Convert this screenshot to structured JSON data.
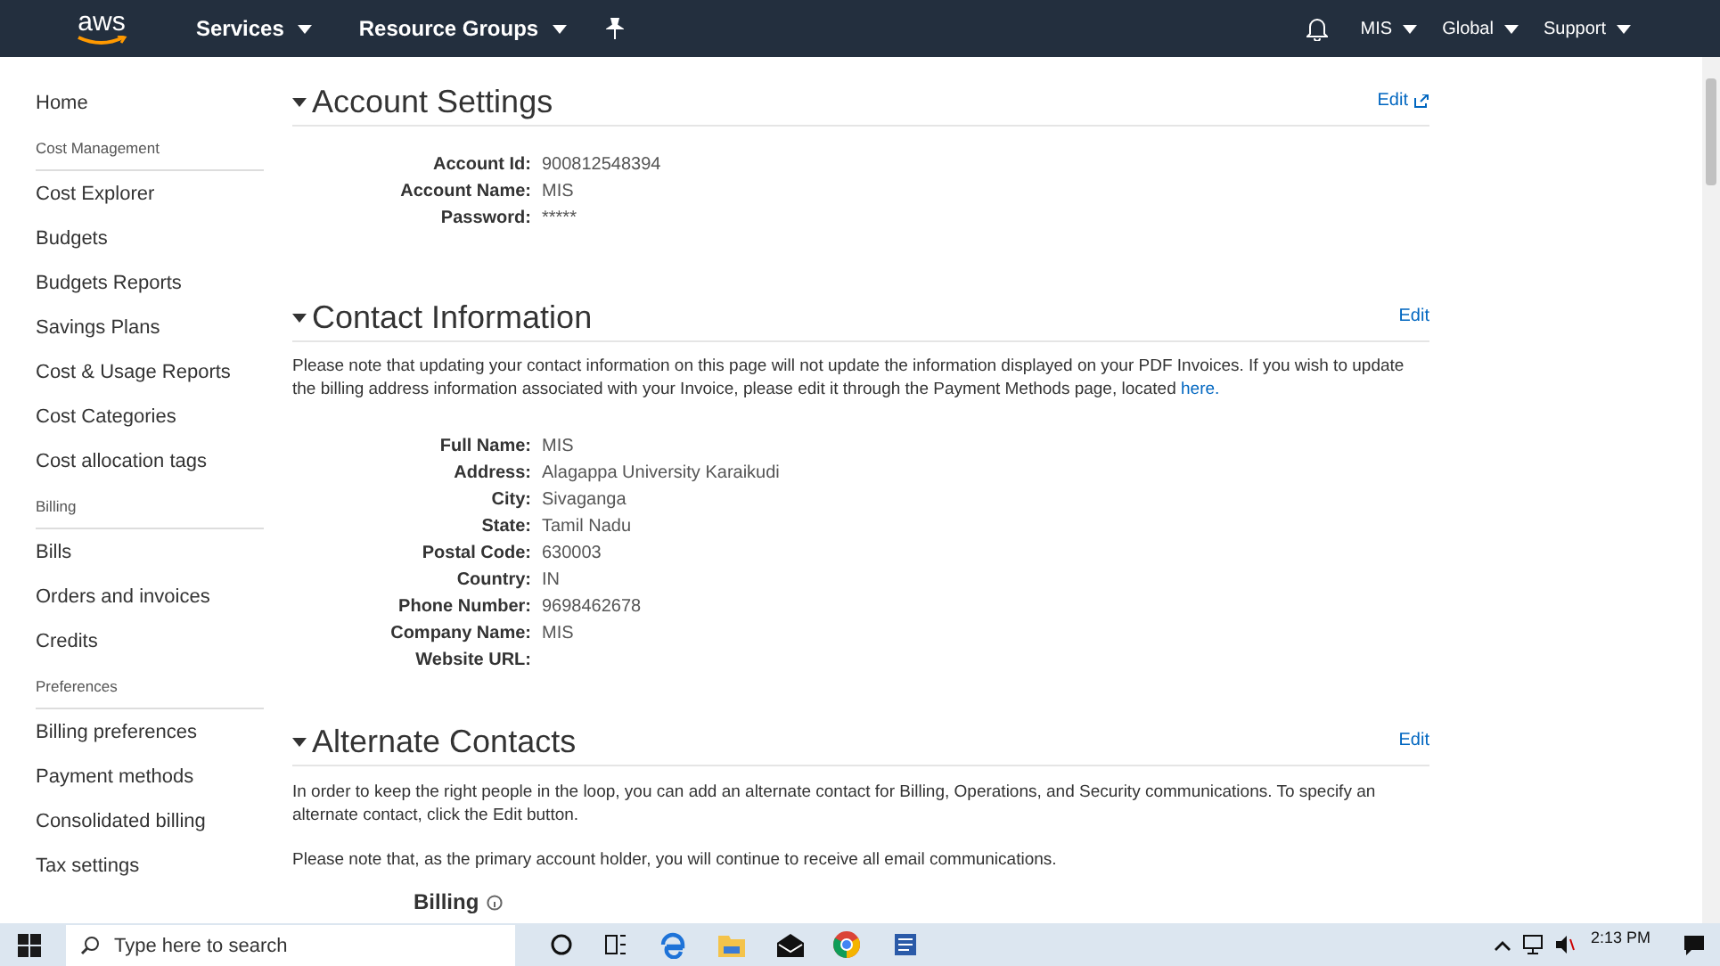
{
  "top_nav": {
    "logo": "aws",
    "menus": [
      {
        "label": "Services"
      },
      {
        "label": "Resource Groups"
      }
    ],
    "right_menus": [
      {
        "label": "MIS"
      },
      {
        "label": "Global"
      },
      {
        "label": "Support"
      }
    ]
  },
  "sidebar": {
    "items": [
      {
        "kind": "link",
        "label": "Home"
      },
      {
        "kind": "heading",
        "label": "Cost Management"
      },
      {
        "kind": "link",
        "label": "Cost Explorer"
      },
      {
        "kind": "link",
        "label": "Budgets"
      },
      {
        "kind": "link",
        "label": "Budgets Reports"
      },
      {
        "kind": "link",
        "label": "Savings Plans"
      },
      {
        "kind": "link",
        "label": "Cost & Usage Reports"
      },
      {
        "kind": "link",
        "label": "Cost Categories"
      },
      {
        "kind": "link",
        "label": "Cost allocation tags"
      },
      {
        "kind": "heading",
        "label": "Billing"
      },
      {
        "kind": "link",
        "label": "Bills"
      },
      {
        "kind": "link",
        "label": "Orders and invoices"
      },
      {
        "kind": "link",
        "label": "Credits"
      },
      {
        "kind": "heading",
        "label": "Preferences"
      },
      {
        "kind": "link",
        "label": "Billing preferences"
      },
      {
        "kind": "link",
        "label": "Payment methods"
      },
      {
        "kind": "link",
        "label": "Consolidated billing"
      },
      {
        "kind": "link",
        "label": "Tax settings"
      }
    ]
  },
  "account_settings": {
    "title": "Account Settings",
    "edit": "Edit",
    "external": true,
    "fields": [
      {
        "label": "Account Id:",
        "value": "900812548394"
      },
      {
        "label": "Account Name:",
        "value": "MIS"
      },
      {
        "label": "Password:",
        "value": "*****"
      }
    ]
  },
  "contact_information": {
    "title": "Contact Information",
    "edit": "Edit",
    "external": false,
    "note": "Please note that updating your contact information on this page will not update the information displayed on your PDF Invoices. If you wish to update the billing address information associated with your Invoice, please edit it through the Payment Methods page, located ",
    "note_link": "here.",
    "fields": [
      {
        "label": "Full Name:",
        "value": "MIS"
      },
      {
        "label": "Address:",
        "value": "Alagappa University Karaikudi"
      },
      {
        "label": "City:",
        "value": "Sivaganga"
      },
      {
        "label": "State:",
        "value": "Tamil Nadu"
      },
      {
        "label": "Postal Code:",
        "value": "630003"
      },
      {
        "label": "Country:",
        "value": "IN"
      },
      {
        "label": "Phone Number:",
        "value": "9698462678"
      },
      {
        "label": "Company Name:",
        "value": "MIS"
      },
      {
        "label": "Website URL:"
      }
    ]
  },
  "alternate_contacts": {
    "title": "Alternate Contacts",
    "edit": "Edit",
    "external": false,
    "paragraphs": [
      "In order to keep the right people in the loop, you can add an alternate contact for Billing, Operations, and Security communications. To specify an alternate contact, click the Edit button.",
      "Please note that, as the primary account holder, you will continue to receive all email communications."
    ],
    "subheading": "Billing"
  },
  "taskbar": {
    "search_placeholder": "Type here to search",
    "time": "2:13 PM"
  }
}
